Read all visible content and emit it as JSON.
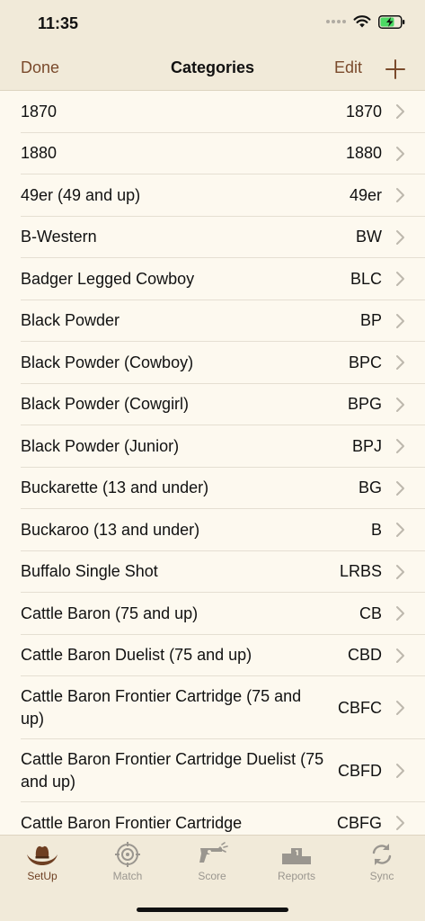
{
  "status_bar": {
    "time": "11:35"
  },
  "nav": {
    "done_label": "Done",
    "title": "Categories",
    "edit_label": "Edit"
  },
  "categories": [
    {
      "name": "1870",
      "code": "1870"
    },
    {
      "name": "1880",
      "code": "1880"
    },
    {
      "name": "49er (49 and up)",
      "code": "49er"
    },
    {
      "name": "B-Western",
      "code": "BW"
    },
    {
      "name": "Badger Legged Cowboy",
      "code": "BLC"
    },
    {
      "name": "Black Powder",
      "code": "BP"
    },
    {
      "name": "Black Powder (Cowboy)",
      "code": "BPC"
    },
    {
      "name": "Black Powder (Cowgirl)",
      "code": "BPG"
    },
    {
      "name": "Black Powder (Junior)",
      "code": "BPJ"
    },
    {
      "name": "Buckarette (13 and under)",
      "code": "BG"
    },
    {
      "name": "Buckaroo (13 and under)",
      "code": "B"
    },
    {
      "name": "Buffalo Single Shot",
      "code": "LRBS"
    },
    {
      "name": "Cattle Baron (75 and up)",
      "code": "CB"
    },
    {
      "name": "Cattle Baron Duelist (75 and up)",
      "code": "CBD"
    },
    {
      "name": "Cattle Baron Frontier Cartridge (75 and up)",
      "code": "CBFC"
    },
    {
      "name": "Cattle Baron Frontier Cartridge Duelist (75 and up)",
      "code": "CBFD"
    },
    {
      "name": "Cattle Baron Frontier Cartridge",
      "code": "CBFG"
    }
  ],
  "tabs": [
    {
      "label": "SetUp",
      "icon": "cowboy-hat-icon",
      "active": true
    },
    {
      "label": "Match",
      "icon": "target-icon",
      "active": false
    },
    {
      "label": "Score",
      "icon": "revolver-icon",
      "active": false
    },
    {
      "label": "Reports",
      "icon": "podium-icon",
      "active": false
    },
    {
      "label": "Sync",
      "icon": "sync-icon",
      "active": false
    }
  ],
  "colors": {
    "accent": "#7a4a2c",
    "bar_background": "#f1ead9",
    "list_background": "#fdf9ef",
    "inactive_tab": "#9a968f",
    "battery": "#4cd964"
  }
}
